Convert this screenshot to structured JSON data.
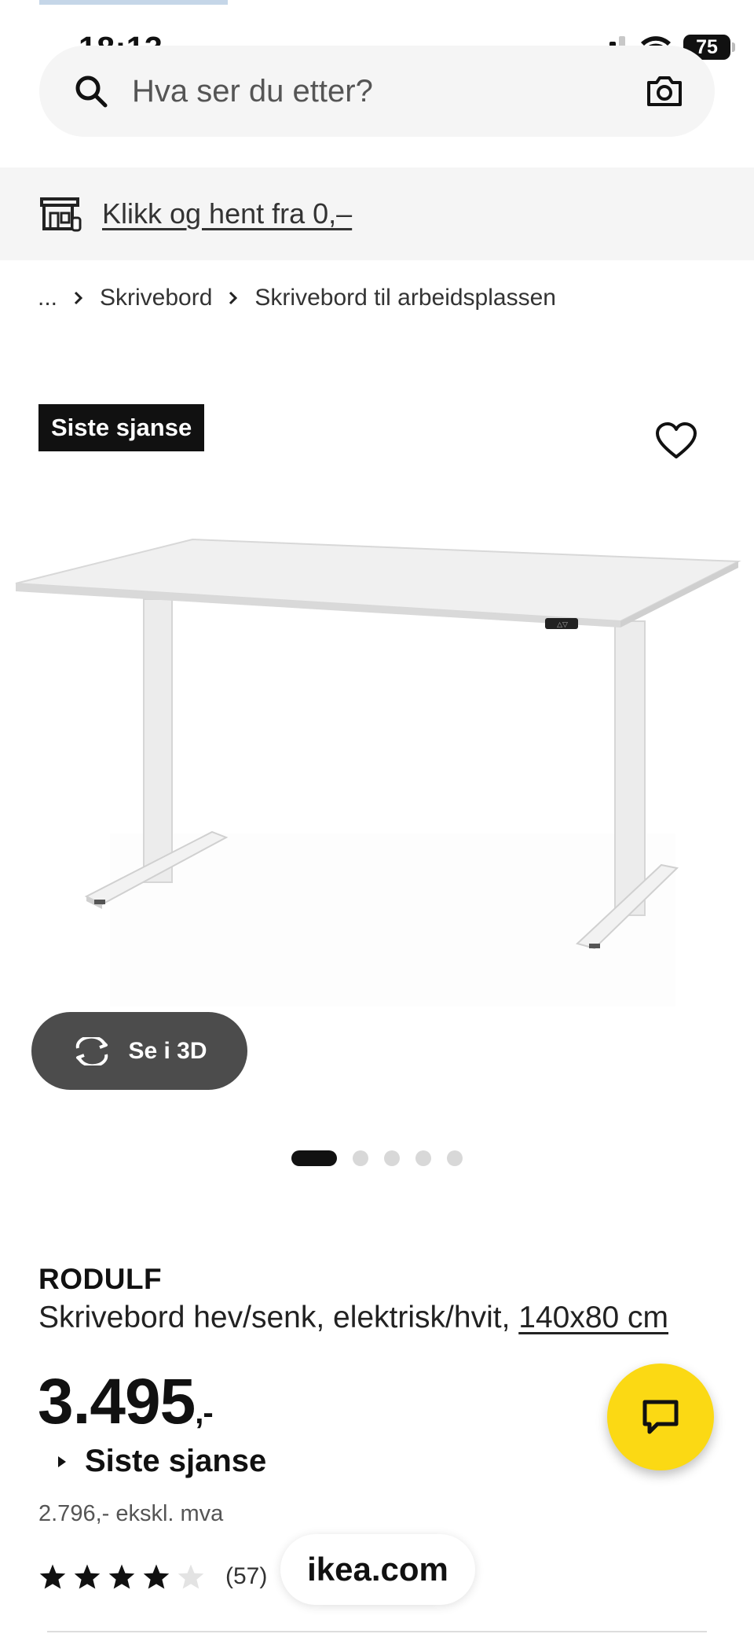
{
  "status_bar": {
    "time": "18:13",
    "battery": "75"
  },
  "search": {
    "placeholder": "Hva ser du etter?"
  },
  "pickup": {
    "link": "Klikk og hent fra 0,–"
  },
  "breadcrumb": {
    "ellipsis": "...",
    "items": [
      "Skrivebord",
      "Skrivebord til arbeidsplassen"
    ]
  },
  "badge": "Siste sjanse",
  "view_3d": {
    "label": "Se i 3D"
  },
  "carousel": {
    "total": 5,
    "active": 1
  },
  "product": {
    "name": "RODULF",
    "description": "Skrivebord hev/senk, elektrisk/hvit,",
    "size": "140x80 cm",
    "price": "3.495",
    "price_suffix": ",-",
    "price_label": "Siste sjanse",
    "price_ex_vat": "2.796,- ekskl. mva",
    "rating": 4,
    "review_count": "(57)"
  },
  "browser": {
    "url": "ikea.com"
  },
  "colors": {
    "chat_button": "#fbd914",
    "badge_bg": "#111111",
    "btn_3d_bg": "#4c4c4c"
  }
}
